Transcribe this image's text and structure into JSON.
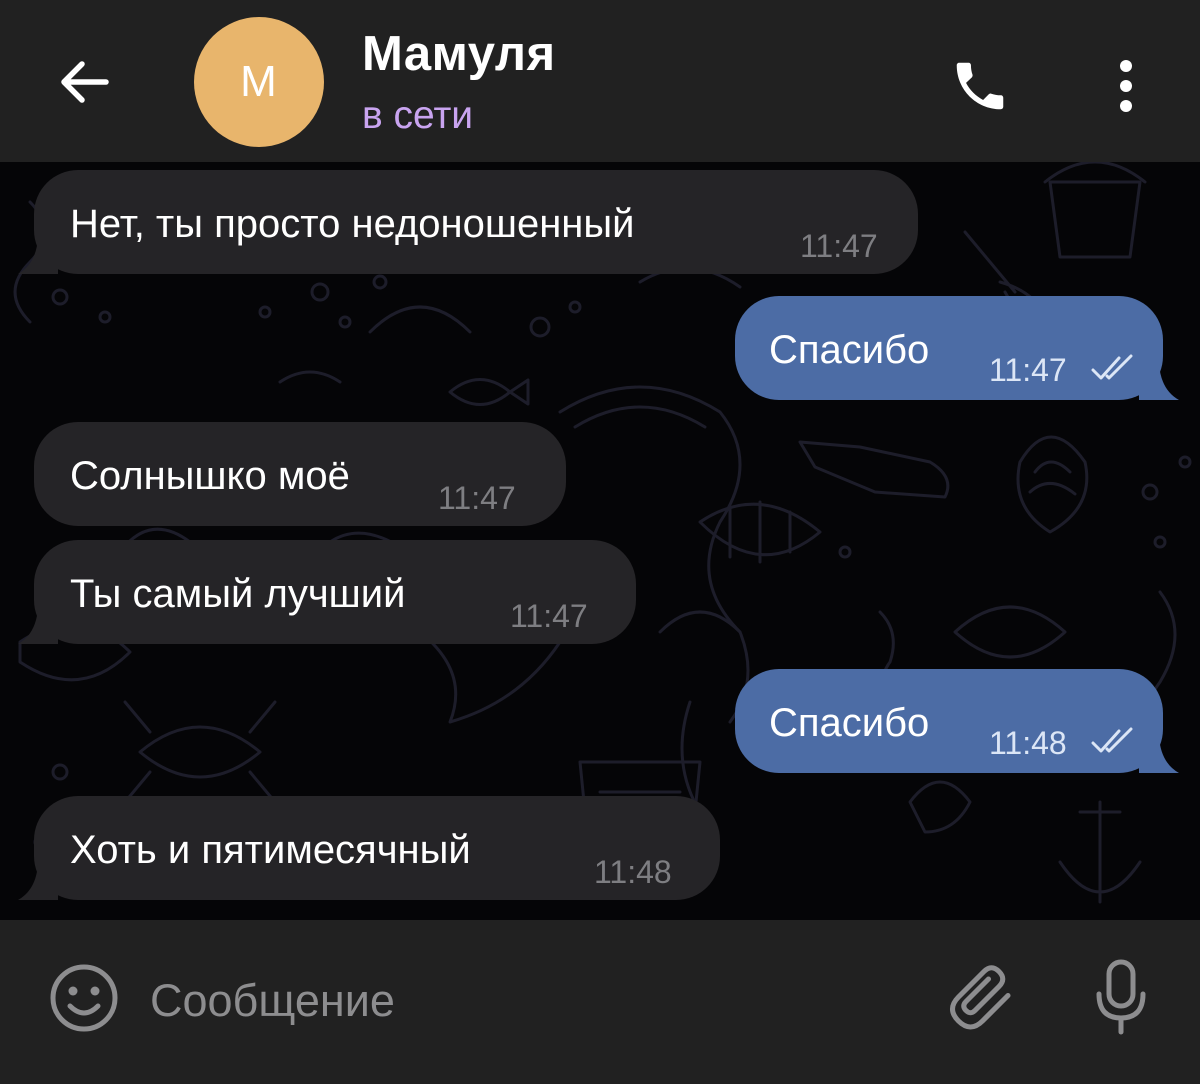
{
  "header": {
    "back_icon": "arrow-left-icon",
    "avatar_initial": "М",
    "avatar_color": "#E8B56C",
    "contact_name": "Мамуля",
    "status": "в сети",
    "status_color": "#C9A4F0",
    "call_icon": "phone-icon",
    "menu_icon": "more-vertical-icon"
  },
  "chat": {
    "background_pattern": "sea-doodles",
    "incoming_bubble_color": "#252427",
    "outgoing_bubble_color": "#4C6CA5",
    "messages": [
      {
        "direction": "incoming",
        "text": "Нет, ты просто недоношенный",
        "time": "11:47"
      },
      {
        "direction": "outgoing",
        "text": "Спасибо",
        "time": "11:47",
        "status_icon": "double-check-icon"
      },
      {
        "direction": "incoming",
        "text": "Солнышко моё",
        "time": "11:47"
      },
      {
        "direction": "incoming",
        "text": "Ты самый лучший",
        "time": "11:47"
      },
      {
        "direction": "outgoing",
        "text": "Спасибо",
        "time": "11:48",
        "status_icon": "double-check-icon"
      },
      {
        "direction": "incoming",
        "text": "Хоть и пятимесячный",
        "time": "11:48"
      }
    ]
  },
  "input_bar": {
    "emoji_icon": "smiley-icon",
    "placeholder": "Сообщение",
    "value": "",
    "attach_icon": "paperclip-icon",
    "mic_icon": "microphone-icon"
  }
}
